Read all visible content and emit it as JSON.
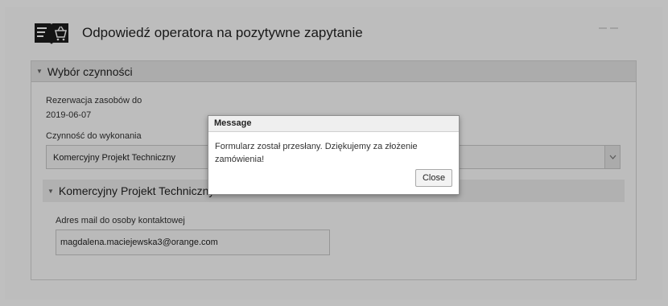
{
  "header": {
    "title": "Odpowiedź operatora na pozytywne zapytanie",
    "logo_icon": "book-basket-icon",
    "corner_icon": "checklist-icon"
  },
  "panel": {
    "title": "Wybór czynności",
    "reservation_label": "Rezerwacja zasobów do",
    "reservation_value": "2019-06-07",
    "action_label": "Czynność do wykonania",
    "action_value": "Komercyjny Projekt Techniczny",
    "sub_panel": {
      "title": "Komercyjny Projekt Techniczny",
      "email_label": "Adres mail do osoby kontaktowej",
      "email_value": "magdalena.maciejewska3@orange.com"
    }
  },
  "dialog": {
    "title": "Message",
    "message": "Formularz został przesłany. Dziękujemy za złożenie zamówienia!",
    "close_label": "Close"
  },
  "colors": {
    "overlay": "#000000",
    "header_bar": "#e6e6e6"
  }
}
